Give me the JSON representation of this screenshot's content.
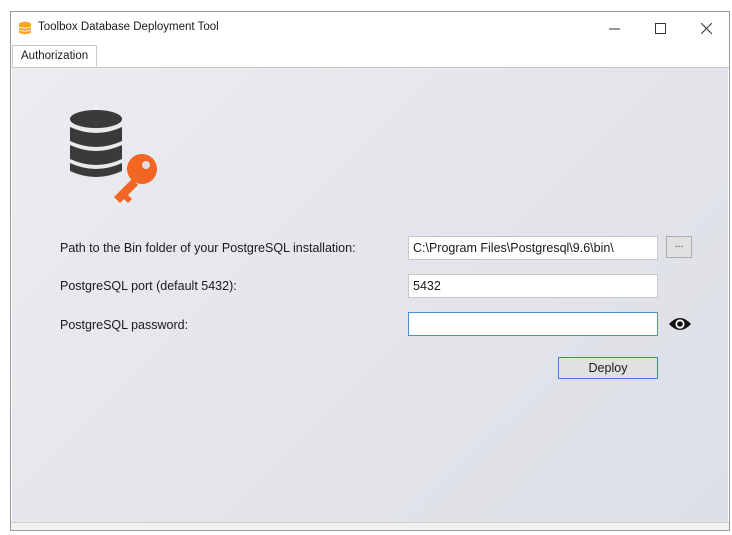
{
  "window": {
    "title": "Toolbox Database Deployment Tool",
    "minimize_glyph": "—",
    "maximize_glyph": "☐",
    "close_glyph": "✕"
  },
  "tabs": [
    {
      "label": "Authorization",
      "selected": true
    }
  ],
  "logo": {
    "icon": "database-key-icon",
    "database_color": "#3a3a3a",
    "key_color": "#f26522"
  },
  "form": {
    "bin_path": {
      "label": "Path to the Bin folder of your PostgreSQL installation:",
      "value": "C:\\Program Files\\Postgresql\\9.6\\bin\\",
      "browse_label": "..."
    },
    "port": {
      "label": "PostgreSQL port (default 5432):",
      "value": "5432"
    },
    "password": {
      "label": "PostgreSQL password:",
      "value": "",
      "toggle_icon": "eye-icon"
    },
    "deploy_label": "Deploy"
  },
  "colors": {
    "accent": "#3c7fd1",
    "orange": "#f26522",
    "dark_gray": "#3a3a3a"
  }
}
